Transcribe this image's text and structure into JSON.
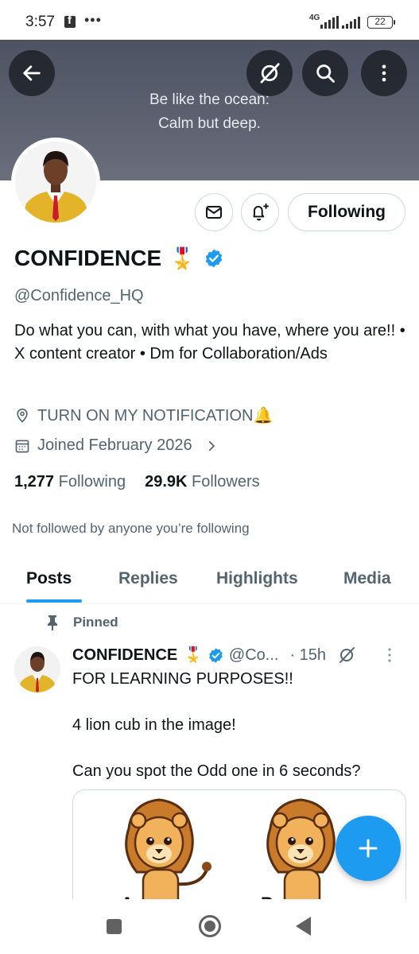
{
  "status_bar": {
    "time": "3:57",
    "network": "4G",
    "battery": "22",
    "icons": [
      "facebook-icon",
      "more-dots-icon",
      "signal-icon",
      "battery-icon"
    ]
  },
  "banner": {
    "line1": "Be like the ocean:",
    "line2": "Calm but deep.",
    "icons": [
      "back-arrow-icon",
      "grok-icon",
      "search-icon",
      "more-vertical-icon"
    ]
  },
  "profile": {
    "display_name": "CONFIDENCE",
    "badge_emoji": "🎖️",
    "handle": "@Confidence_HQ",
    "bio": "Do what you can, with what you have, where you are!! • X content creator • Dm for Collaboration/Ads",
    "location": "TURN ON MY NOTIFICATION🔔",
    "joined": "Joined February 2026",
    "following_count": "1,277",
    "following_label": "Following",
    "followers_count": "29.9K",
    "followers_label": "Followers",
    "not_followed": "Not followed by anyone you’re following"
  },
  "actions": {
    "following_button": "Following",
    "icons": [
      "mail-icon",
      "notification-bell-plus-icon"
    ]
  },
  "tabs": [
    "Posts",
    "Replies",
    "Highlights",
    "Media"
  ],
  "active_tab": "Posts",
  "post": {
    "pinned_label": "Pinned",
    "author": "CONFIDENCE",
    "badge_emoji": "🎖️",
    "handle": "@Co...",
    "time": "· 15h",
    "line1": "FOR LEARNING PURPOSES!!",
    "line2": "4 lion cub in the image!",
    "line3": "Can you spot the Odd one in 6 seconds?",
    "media_labels": [
      "A",
      "B"
    ]
  },
  "colors": {
    "accent": "#1d9bf0",
    "text_primary": "#0f1419",
    "text_secondary": "#536471",
    "border": "#cfd9de",
    "banner": "#5a5f6d"
  },
  "nav_bar": {
    "icons": [
      "recent-apps-icon",
      "home-icon",
      "back-icon"
    ]
  }
}
